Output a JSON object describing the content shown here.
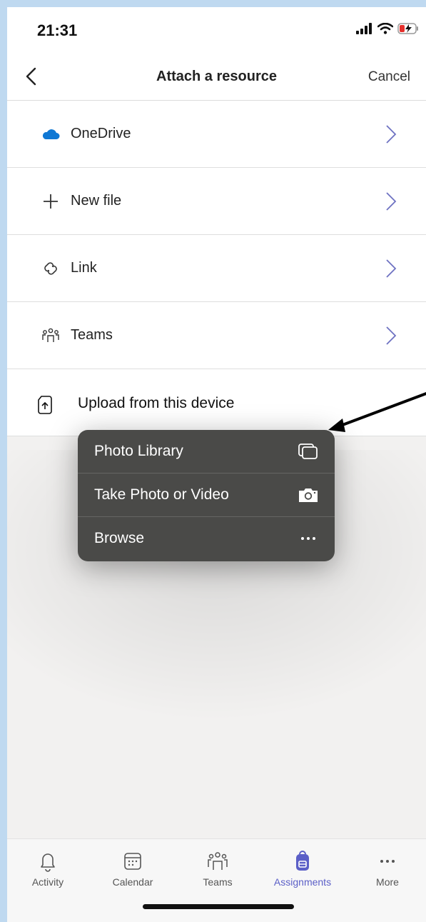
{
  "status": {
    "time": "21:31"
  },
  "nav": {
    "title": "Attach a resource",
    "cancel_label": "Cancel"
  },
  "list": {
    "items": [
      {
        "label": "OneDrive",
        "icon": "cloud-icon"
      },
      {
        "label": "New file",
        "icon": "plus-icon"
      },
      {
        "label": "Link",
        "icon": "link-icon"
      },
      {
        "label": "Teams",
        "icon": "teams-icon"
      }
    ],
    "upload_label": "Upload from this device"
  },
  "popup": {
    "items": [
      {
        "label": "Photo Library",
        "icon": "photo-library-icon"
      },
      {
        "label": "Take Photo or Video",
        "icon": "camera-icon"
      },
      {
        "label": "Browse",
        "icon": "ellipsis-icon"
      }
    ]
  },
  "tabs": [
    {
      "label": "Activity",
      "icon": "bell-icon"
    },
    {
      "label": "Calendar",
      "icon": "calendar-icon"
    },
    {
      "label": "Teams",
      "icon": "teams-icon"
    },
    {
      "label": "Assignments",
      "icon": "backpack-icon",
      "active": true
    },
    {
      "label": "More",
      "icon": "ellipsis-icon"
    }
  ],
  "colors": {
    "accent": "#5b5fc7",
    "onedrive": "#0f78d4",
    "menu_bg": "#4a4a48",
    "background_frame": "#bfd9f0"
  }
}
